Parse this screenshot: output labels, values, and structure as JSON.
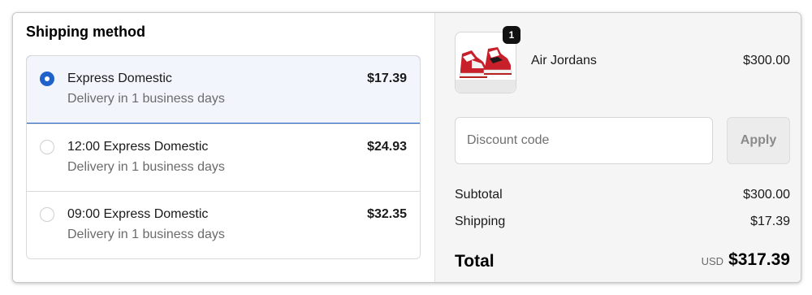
{
  "shipping": {
    "title": "Shipping method",
    "options": [
      {
        "name": "Express Domestic",
        "subtitle": "Delivery in 1 business days",
        "price": "$17.39",
        "selected": true
      },
      {
        "name": "12:00 Express Domestic",
        "subtitle": "Delivery in 1 business days",
        "price": "$24.93",
        "selected": false
      },
      {
        "name": "09:00 Express Domestic",
        "subtitle": "Delivery in 1 business days",
        "price": "$32.35",
        "selected": false
      }
    ]
  },
  "summary": {
    "product": {
      "name": "Air Jordans",
      "price": "$300.00",
      "quantity": "1",
      "image_icon": "sneaker-product-image"
    },
    "discount": {
      "placeholder": "Discount code",
      "value": "",
      "apply_label": "Apply"
    },
    "subtotal_label": "Subtotal",
    "subtotal_value": "$300.00",
    "shipping_label": "Shipping",
    "shipping_value": "$17.39",
    "total_label": "Total",
    "total_currency": "USD",
    "total_value": "$317.39"
  },
  "colors": {
    "accent": "#1f62c9",
    "selected_bg": "#f3f5fd",
    "summary_bg": "#f5f5f5"
  }
}
